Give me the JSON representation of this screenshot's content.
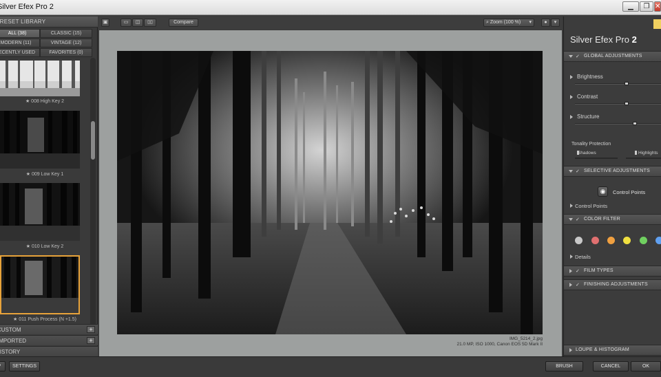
{
  "window": {
    "title": "Silver Efex Pro 2",
    "minimize_label": "▁",
    "restore_label": "❐",
    "close_label": "✕"
  },
  "left": {
    "header": "PRESET LIBRARY",
    "filters": [
      {
        "label": "ALL (38)",
        "active": true
      },
      {
        "label": "CLASSIC (15)"
      },
      {
        "label": "MODERN (11)"
      },
      {
        "label": "VINTAGE (12)"
      },
      {
        "label": "RECENTLY USED"
      },
      {
        "label": "FAVORITES (0)"
      }
    ],
    "presets": [
      {
        "label": "★ 008 High Key 2"
      },
      {
        "label": "★ 009 Low Key 1"
      },
      {
        "label": "★ 010 Low Key 2"
      },
      {
        "label": "★ 011 Push Process (N +1.5)"
      }
    ],
    "sections": [
      {
        "label": "CUSTOM",
        "plus": "+"
      },
      {
        "label": "IMPORTED",
        "plus": "+"
      },
      {
        "label": "HISTORY"
      }
    ]
  },
  "toolbar": {
    "compare_label": "Compare",
    "zoom_label": "Zoom (100 %)",
    "zoom_arrow": "▾"
  },
  "image": {
    "filename": "IMG_5214_2.jpg",
    "meta": "21.0 MP, ISO 1000, Canon EOS 5D Mark II"
  },
  "right": {
    "brand_name": "Silver Efex Pro",
    "brand_version": "2",
    "global_adjustments": "GLOBAL ADJUSTMENTS",
    "brightness": {
      "label": "Brightness",
      "value": 0.6
    },
    "contrast": {
      "label": "Contrast",
      "value": 0.6
    },
    "structure": {
      "label": "Structure",
      "value": 0.7
    },
    "tonality_protection": "Tonality Protection",
    "shadows": "Shadows",
    "highlights": "Highlights",
    "selective_adjustments": "SELECTIVE ADJUSTMENTS",
    "control_points_button": "Control Points",
    "control_points_list": "Control Points",
    "color_filter": "COLOR FILTER",
    "filter_colors": [
      "#c8c8c8",
      "#e07070",
      "#f0a040",
      "#f0e040",
      "#70d060",
      "#60a0f0"
    ],
    "details": "Details",
    "film_types": "FILM TYPES",
    "finishing_adjustments": "FINISHING ADJUSTMENTS",
    "loupe_histogram": "LOUPE & HISTOGRAM",
    "check_mark": "✓"
  },
  "bottom": {
    "help_label": "HELP",
    "settings_label": "SETTINGS",
    "brush_label": "BRUSH",
    "cancel_label": "CANCEL",
    "ok_label": "OK"
  }
}
